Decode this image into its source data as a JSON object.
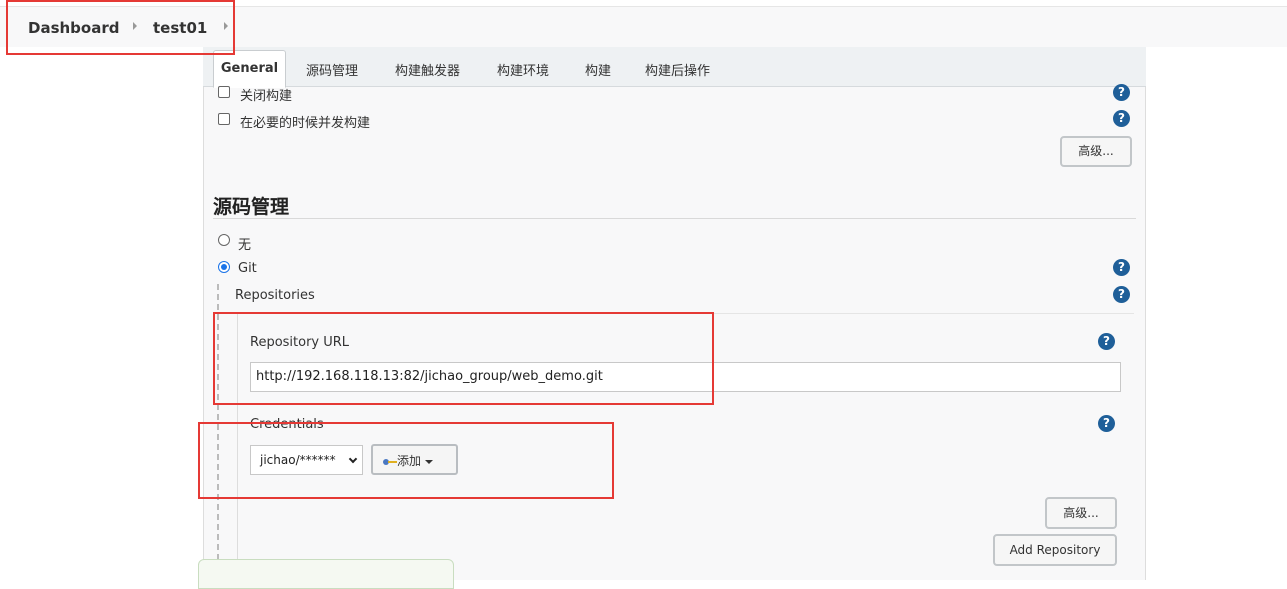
{
  "breadcrumb": {
    "items": [
      "Dashboard",
      "test01"
    ]
  },
  "tabs": [
    "General",
    "源码管理",
    "构建触发器",
    "构建环境",
    "构建",
    "构建后操作"
  ],
  "active_tab": "General",
  "general": {
    "options": [
      {
        "label": "关闭构建",
        "checked": false
      },
      {
        "label": "在必要的时候并发构建",
        "checked": false
      }
    ],
    "advanced_button": "高级..."
  },
  "scm": {
    "title": "源码管理",
    "choices": [
      {
        "label": "无",
        "selected": false
      },
      {
        "label": "Git",
        "selected": true
      }
    ],
    "repositories_label": "Repositories",
    "repository_url_label": "Repository URL",
    "repository_url_value": "http://192.168.118.13:82/jichao_group/web_demo.git",
    "credentials_label": "Credentials",
    "credentials_selected": "jichao/******",
    "add_button": "添加",
    "advanced_button": "高级...",
    "add_repository_button": "Add Repository"
  },
  "icons": {
    "help": "help-icon",
    "breadcrumb_separator": "chevron-right-icon",
    "credential_key": "key-icon"
  },
  "colors": {
    "highlight_box": "#e53935",
    "help_icon": "#1f5f99",
    "radio_selected": "#1a73e8"
  }
}
